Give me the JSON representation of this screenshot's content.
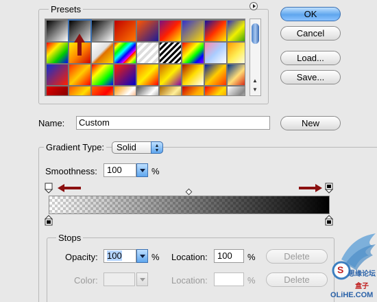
{
  "presets": {
    "title": "Presets",
    "swatches": [
      "linear-gradient(135deg,#000 0%,#fff 100%)",
      "linear-gradient(135deg,#000 0%,#ddd 100%)",
      "linear-gradient(135deg,#000,#fff)",
      "linear-gradient(135deg,#c00000,#ff7700)",
      "linear-gradient(135deg,#ff5500,#1a1a99)",
      "linear-gradient(135deg,#7a1080,#ff2000,#ffee00)",
      "linear-gradient(135deg,#3030d0,#ffdd00)",
      "linear-gradient(135deg,#1010a0,#ff3000,#ffee00)",
      "linear-gradient(135deg,#2a2ac0,#f0f000,#109010)",
      "linear-gradient(135deg,#ff0000,#ffee00,#00cc00,#0000ff)",
      "linear-gradient(135deg,#ffee00,#ff8800,#cc0000)",
      "linear-gradient(135deg,#ffffff,#e0e0e0 45%,#e07000 55%,#ffdd00)",
      "repeating-linear-gradient(135deg,#ff0000,#ffff00 6px,#00ff00 12px,#00ffff 18px,#0000ff 24px,#ff00ff 30px)",
      "repeating-linear-gradient(135deg,#fff 0 4px,#ddd 4px 8px)",
      "repeating-linear-gradient(135deg,#000 0 3px,#fff 3px 6px)",
      "linear-gradient(135deg,#ff0000,#ff8800,#ffff00,#00ff00,#0000ff,#8800ff)",
      "linear-gradient(135deg,#ff88aa,#aaccff,#ffffff)",
      "linear-gradient(135deg,#ff9900,#ffee55,#ffffff)",
      "linear-gradient(135deg,#1030d0,#ff2000)",
      "linear-gradient(135deg,#ff3000,#ffcc00,#ff0000)",
      "linear-gradient(135deg,#ff0000,#ffff00,#00ff00,#0000ff)",
      "linear-gradient(135deg,#ff2200,#0000cc)",
      "linear-gradient(135deg,#ff7700,#ffee00,#ff0000)",
      "linear-gradient(135deg,#cc6600,#ffee00,#8800aa)",
      "linear-gradient(135deg,#aa1100,#ffdd00,#ffffff)",
      "linear-gradient(135deg,#0022aa,#ffcc00,#ff3300)",
      "linear-gradient(135deg,#003388,#ffdd77,#cc0000)",
      "linear-gradient(135deg,#dd0000,#660000)",
      "linear-gradient(135deg,#ff5500,#ffdd00,#ff0000)",
      "linear-gradient(135deg,#ff6600,#ff0000,#ffee00)",
      "linear-gradient(135deg,#ff9900,#ffffff,#ff6600)",
      "linear-gradient(135deg,#555555,#ffffff,#555555)",
      "linear-gradient(135deg,#aa6600,#ffee99,#885500)",
      "linear-gradient(135deg,#cc0000,#ffaa00,#ffee00)",
      "linear-gradient(135deg,#ff0000,#ffdd00,#ff6600)",
      "linear-gradient(135deg,#ffffff,#888888,#ffffff)"
    ]
  },
  "buttons": {
    "ok": "OK",
    "cancel": "Cancel",
    "load": "Load...",
    "save": "Save...",
    "new": "New"
  },
  "name": {
    "label": "Name:",
    "value": "Custom"
  },
  "gradient": {
    "legend": "Gradient Type:",
    "type_value": "Solid",
    "smoothness_label": "Smoothness:",
    "smoothness_value": "100",
    "smoothness_unit": "%"
  },
  "stops": {
    "title": "Stops",
    "opacity_label": "Opacity:",
    "opacity_value": "100",
    "opacity_unit": "%",
    "opacity_location_label": "Location:",
    "opacity_location_value": "100",
    "opacity_location_unit": "%",
    "delete_label": "Delete",
    "color_label": "Color:",
    "color_location_label": "Location:",
    "color_location_value": "",
    "color_location_unit": "%"
  },
  "colors": {
    "accent_blue": "#5fa6ee",
    "annotation_red": "#8b1010"
  },
  "watermark": {
    "text_top": "S",
    "text_cn": "思缘论坛",
    "text_box": "盒子",
    "text_site": "OLiHE.COM"
  }
}
